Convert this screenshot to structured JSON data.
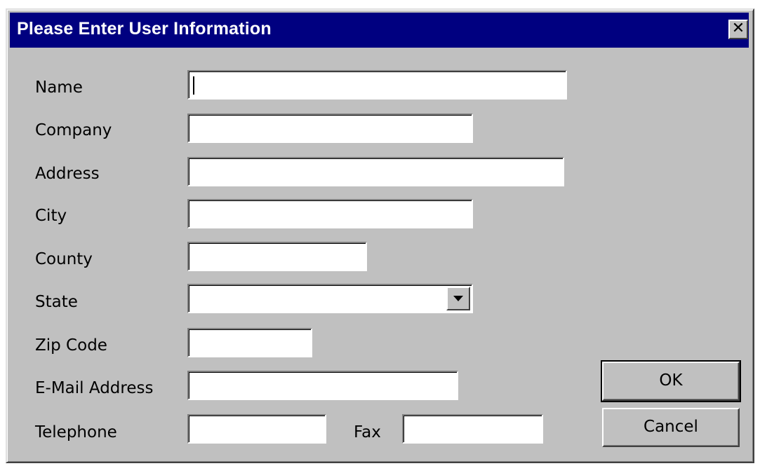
{
  "dialog": {
    "title": "Please Enter User Information",
    "close_symbol": "✕"
  },
  "fields": {
    "name": {
      "label": "Name",
      "value": ""
    },
    "company": {
      "label": "Company",
      "value": ""
    },
    "address": {
      "label": "Address",
      "value": ""
    },
    "city": {
      "label": "City",
      "value": ""
    },
    "county": {
      "label": "County",
      "value": ""
    },
    "state": {
      "label": "State",
      "value": ""
    },
    "zip": {
      "label": "Zip Code",
      "value": ""
    },
    "email": {
      "label": "E-Mail Address",
      "value": ""
    },
    "telephone": {
      "label": "Telephone",
      "value": ""
    },
    "fax": {
      "label": "Fax",
      "value": ""
    }
  },
  "buttons": {
    "ok_label": "OK",
    "cancel_label": "Cancel"
  },
  "colors": {
    "titlebar": "#000080",
    "dialog_face": "#c0c0c0"
  }
}
